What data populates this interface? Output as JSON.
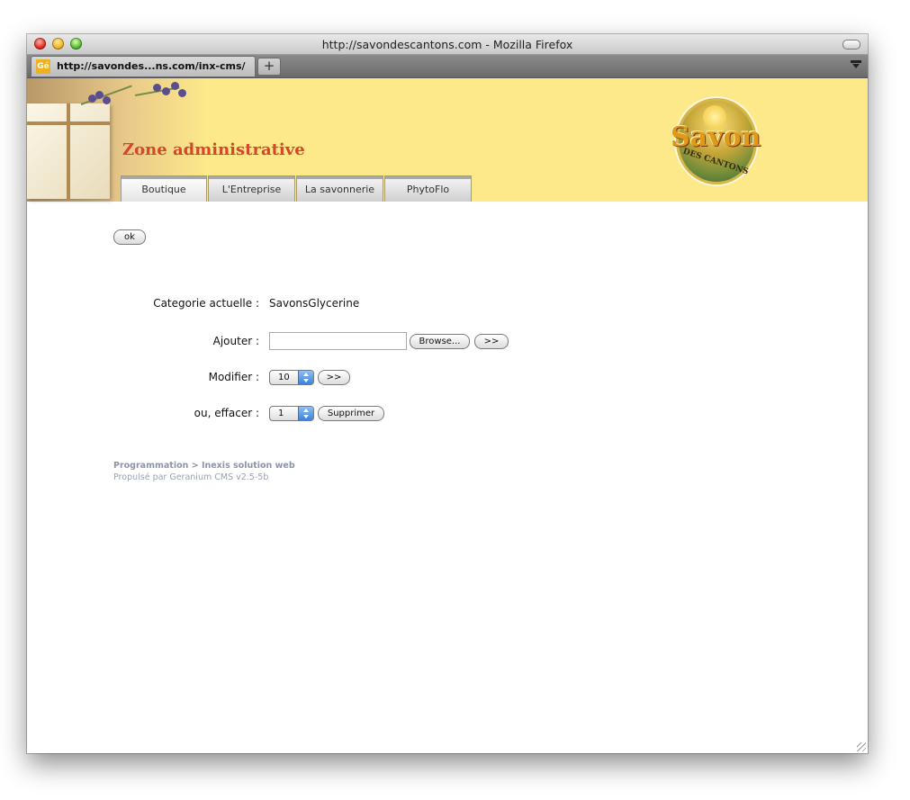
{
  "window": {
    "title": "http://savondescantons.com - Mozilla Firefox"
  },
  "browser_tabs": [
    {
      "favicon_text": "Gé",
      "label": "http://savondes...ns.com/inx-cms/"
    }
  ],
  "new_tab_label": "+",
  "banner": {
    "heading": "Zone administrative",
    "logo_text": "Savon",
    "logo_subtext": "DES CANTONS"
  },
  "nav_tabs": [
    {
      "label": "Boutique"
    },
    {
      "label": "L'Entreprise"
    },
    {
      "label": "La savonnerie"
    },
    {
      "label": "PhytoFlo"
    }
  ],
  "form": {
    "ok_label": "ok",
    "current_category_label": "Categorie actuelle :",
    "current_category_value": "SavonsGlycerine",
    "add_label": "Ajouter :",
    "browse_label": "Browse...",
    "add_submit_label": ">>",
    "modify_label": "Modifier :",
    "modify_select_value": "10",
    "modify_submit_label": ">>",
    "delete_label": "ou, effacer :",
    "delete_select_value": "1",
    "delete_submit_label": "Supprimer"
  },
  "footer": {
    "programming_link": "Programmation > Inexis solution web",
    "powered_by": "Propulsé par Geranium CMS v2.5-5b"
  },
  "colors": {
    "banner_yellow": "#fde98a",
    "heading_red": "#d8452a",
    "footer_text": "#8a94a8",
    "select_blue": "#3d80dc"
  }
}
